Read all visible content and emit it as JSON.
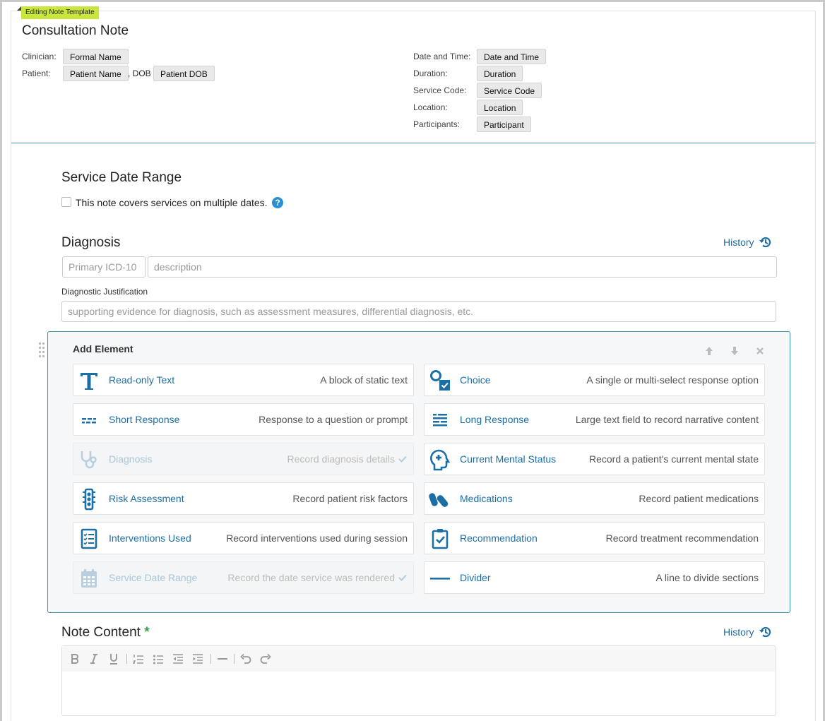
{
  "badge": "Editing Note Template",
  "title": "Consultation Note",
  "meta_left": {
    "clinician_label": "Clinician:",
    "clinician_token": "Formal Name",
    "patient_label": "Patient:",
    "patient_token": "Patient Name",
    "dob_text": ", DOB",
    "dob_token": "Patient DOB"
  },
  "meta_right": [
    {
      "label": "Date and Time:",
      "token": "Date and Time"
    },
    {
      "label": "Duration:",
      "token": "Duration"
    },
    {
      "label": "Service Code:",
      "token": "Service Code"
    },
    {
      "label": "Location:",
      "token": "Location"
    },
    {
      "label": "Participants:",
      "token": "Participant"
    }
  ],
  "service_date_range": {
    "title": "Service Date Range",
    "checkbox_label": "This note covers services on multiple dates.",
    "help_glyph": "?"
  },
  "diagnosis": {
    "title": "Diagnosis",
    "history": "History",
    "icd_placeholder": "Primary ICD-10",
    "desc_placeholder": "description",
    "justification_label": "Diagnostic Justification",
    "justification_placeholder": "supporting evidence for diagnosis, such as assessment measures, differential diagnosis, etc."
  },
  "add_element": {
    "title": "Add Element",
    "controls": [
      "arrow-up-icon",
      "arrow-down-icon",
      "close-icon"
    ],
    "items": [
      {
        "name": "Read-only Text",
        "desc": "A block of static text",
        "icon": "text-t-icon",
        "disabled": false
      },
      {
        "name": "Choice",
        "desc": "A single or multi-select response option",
        "icon": "choice-icon",
        "disabled": false
      },
      {
        "name": "Short Response",
        "desc": "Response to a question or prompt",
        "icon": "short-response-icon",
        "disabled": false
      },
      {
        "name": "Long Response",
        "desc": "Large text field to record narrative content",
        "icon": "long-response-icon",
        "disabled": false
      },
      {
        "name": "Diagnosis",
        "desc": "Record diagnosis details",
        "icon": "stethoscope-icon",
        "disabled": true
      },
      {
        "name": "Current Mental Status",
        "desc": "Record a patient's current mental state",
        "icon": "head-plus-icon",
        "disabled": false
      },
      {
        "name": "Risk Assessment",
        "desc": "Record patient risk factors",
        "icon": "traffic-light-icon",
        "disabled": false
      },
      {
        "name": "Medications",
        "desc": "Record patient medications",
        "icon": "pills-icon",
        "disabled": false
      },
      {
        "name": "Interventions Used",
        "desc": "Record interventions used during session",
        "icon": "checklist-icon",
        "disabled": false
      },
      {
        "name": "Recommendation",
        "desc": "Record treatment recommendation",
        "icon": "clipboard-check-icon",
        "disabled": false
      },
      {
        "name": "Service Date Range",
        "desc": "Record the date service was rendered",
        "icon": "calendar-icon",
        "disabled": true
      },
      {
        "name": "Divider",
        "desc": "A line to divide sections",
        "icon": "divider-icon",
        "disabled": false
      }
    ]
  },
  "note_content": {
    "title": "Note Content",
    "required_mark": "*",
    "history": "History",
    "toolbar": [
      "bold-icon",
      "italic-icon",
      "underline-icon",
      "ordered-list-icon",
      "bullet-list-icon",
      "outdent-icon",
      "indent-icon",
      "horizontal-rule-icon",
      "undo-icon",
      "redo-icon"
    ]
  },
  "colors": {
    "accent": "#1c6fa5",
    "teal_border": "#3a9aa6",
    "badge": "#c8e63c",
    "required": "#3aa24a"
  }
}
